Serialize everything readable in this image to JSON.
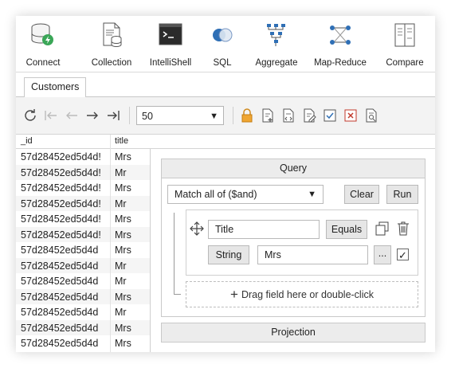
{
  "ribbon": {
    "items": [
      {
        "label": "Connect",
        "icon": "database-connect-icon"
      },
      {
        "label": "Collection",
        "icon": "collection-icon"
      },
      {
        "label": "IntelliShell",
        "icon": "terminal-icon"
      },
      {
        "label": "SQL",
        "icon": "sql-icon"
      },
      {
        "label": "Aggregate",
        "icon": "aggregate-icon"
      },
      {
        "label": "Map-Reduce",
        "icon": "map-reduce-icon"
      },
      {
        "label": "Compare",
        "icon": "compare-icon"
      }
    ]
  },
  "tab": {
    "label": "Customers"
  },
  "toolbar": {
    "page_size": "50"
  },
  "grid": {
    "columns": [
      "_id",
      "title"
    ],
    "rows": [
      {
        "id": "57d28452ed5d4d!",
        "title": "Mrs"
      },
      {
        "id": "57d28452ed5d4d!",
        "title": "Mr"
      },
      {
        "id": "57d28452ed5d4d!",
        "title": "Mrs"
      },
      {
        "id": "57d28452ed5d4d!",
        "title": "Mr"
      },
      {
        "id": "57d28452ed5d4d!",
        "title": "Mrs"
      },
      {
        "id": "57d28452ed5d4d!",
        "title": "Mrs"
      },
      {
        "id": "57d28452ed5d4d",
        "title": "Mrs"
      },
      {
        "id": "57d28452ed5d4d",
        "title": "Mr"
      },
      {
        "id": "57d28452ed5d4d",
        "title": "Mr"
      },
      {
        "id": "57d28452ed5d4d",
        "title": "Mrs"
      },
      {
        "id": "57d28452ed5d4d",
        "title": "Mr"
      },
      {
        "id": "57d28452ed5d4d",
        "title": "Mrs"
      },
      {
        "id": "57d28452ed5d4d",
        "title": "Mrs"
      }
    ]
  },
  "query": {
    "header": "Query",
    "match_mode": "Match all of ($and)",
    "clear_label": "Clear",
    "run_label": "Run",
    "field_name": "Title",
    "operator": "Equals",
    "type": "String",
    "value": "Mrs",
    "more_label": "...",
    "checked": "✓",
    "drop_hint": "Drag field here or double-click"
  },
  "projection": {
    "header": "Projection"
  },
  "colors": {
    "accent": "#2f6fb5",
    "header_bg": "#ececec",
    "toolbar_bg": "#f3f3f3"
  }
}
